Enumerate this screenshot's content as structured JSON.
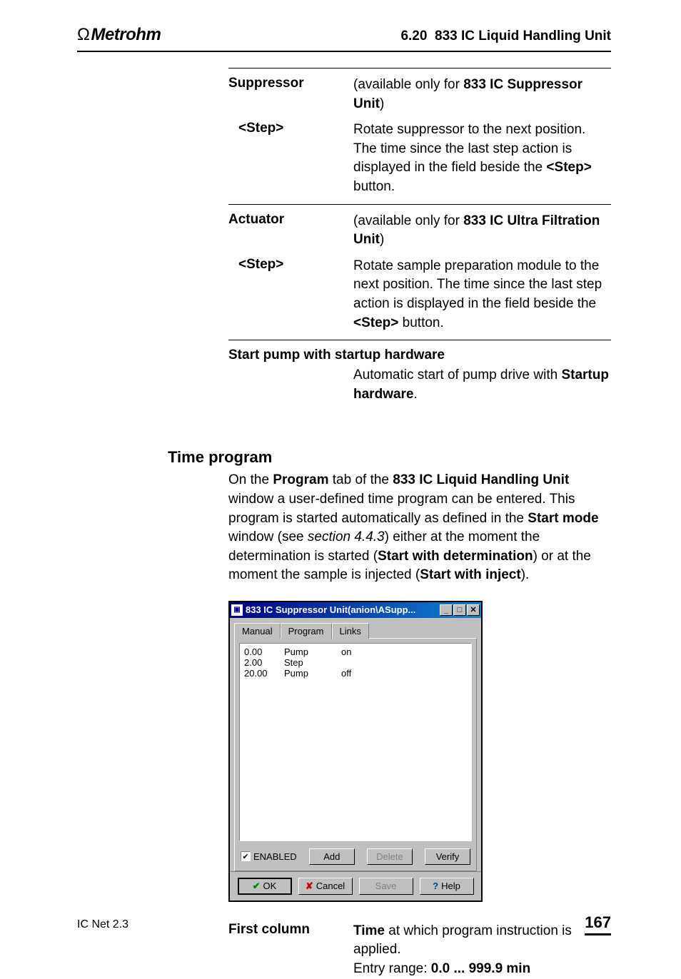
{
  "header": {
    "logo_brand": "Metrohm",
    "section_number": "6.20",
    "section_title": "833 IC Liquid Handling Unit"
  },
  "params": {
    "suppressor": {
      "label": "Suppressor",
      "desc_prefix": "(available only for ",
      "desc_bold": "833 IC Suppressor Unit",
      "desc_suffix": ")"
    },
    "suppressor_step": {
      "label": "<Step>",
      "desc_1": "Rotate suppressor to the next position. The time since the last step action is displayed in the field beside the ",
      "desc_bold": "<Step>",
      "desc_2": " button."
    },
    "actuator": {
      "label": "Actuator",
      "desc_prefix": "(available only for ",
      "desc_bold": "833 IC Ultra Filtration Unit",
      "desc_suffix": ")"
    },
    "actuator_step": {
      "label": "<Step>",
      "desc_1": "Rotate sample preparation module to the next position. The time since the last step action is displayed in the field beside the ",
      "desc_bold": "<Step>",
      "desc_2": " button."
    },
    "startup": {
      "label": "Start pump with startup hardware",
      "desc_1": "Automatic start of pump drive with ",
      "desc_bold": "Startup hardware",
      "desc_2": "."
    }
  },
  "time_program": {
    "heading": "Time program",
    "p1": "On the ",
    "p1_b1": "Program",
    "p1_2": " tab of the ",
    "p1_b2": "833 IC Liquid Handling Unit",
    "p1_3": " window a user-defined time program can be entered. This program is started automatically as defined in the ",
    "p1_b3": "Start mode",
    "p1_4": " window (see ",
    "p1_i1": "section 4.4.3",
    "p1_5": ") either at the moment the determination is started (",
    "p1_b4": "Start with determination",
    "p1_6": ") or at the moment the sample is injected (",
    "p1_b5": "Start with inject",
    "p1_7": ")."
  },
  "dialog": {
    "title": "833 IC Suppressor Unit(anion\\ASupp...",
    "tabs": {
      "manual": "Manual",
      "program": "Program",
      "links": "Links"
    },
    "rows": [
      {
        "time": "0.00",
        "cmd": "Pump",
        "arg": "on"
      },
      {
        "time": "2.00",
        "cmd": "Step",
        "arg": ""
      },
      {
        "time": "20.00",
        "cmd": "Pump",
        "arg": "off"
      }
    ],
    "enabled_label": "ENABLED",
    "buttons": {
      "add": "Add",
      "delete": "Delete",
      "verify": "Verify",
      "ok": "OK",
      "cancel": "Cancel",
      "save": "Save",
      "help": "Help"
    }
  },
  "first_column": {
    "label": "First column",
    "desc_b": "Time",
    "desc_1": " at which program instruction is applied.",
    "desc_2": "Entry range: ",
    "desc_b2": "0.0 ... 999.9 min"
  },
  "footer": {
    "product": "IC Net 2.3",
    "page": "167"
  }
}
